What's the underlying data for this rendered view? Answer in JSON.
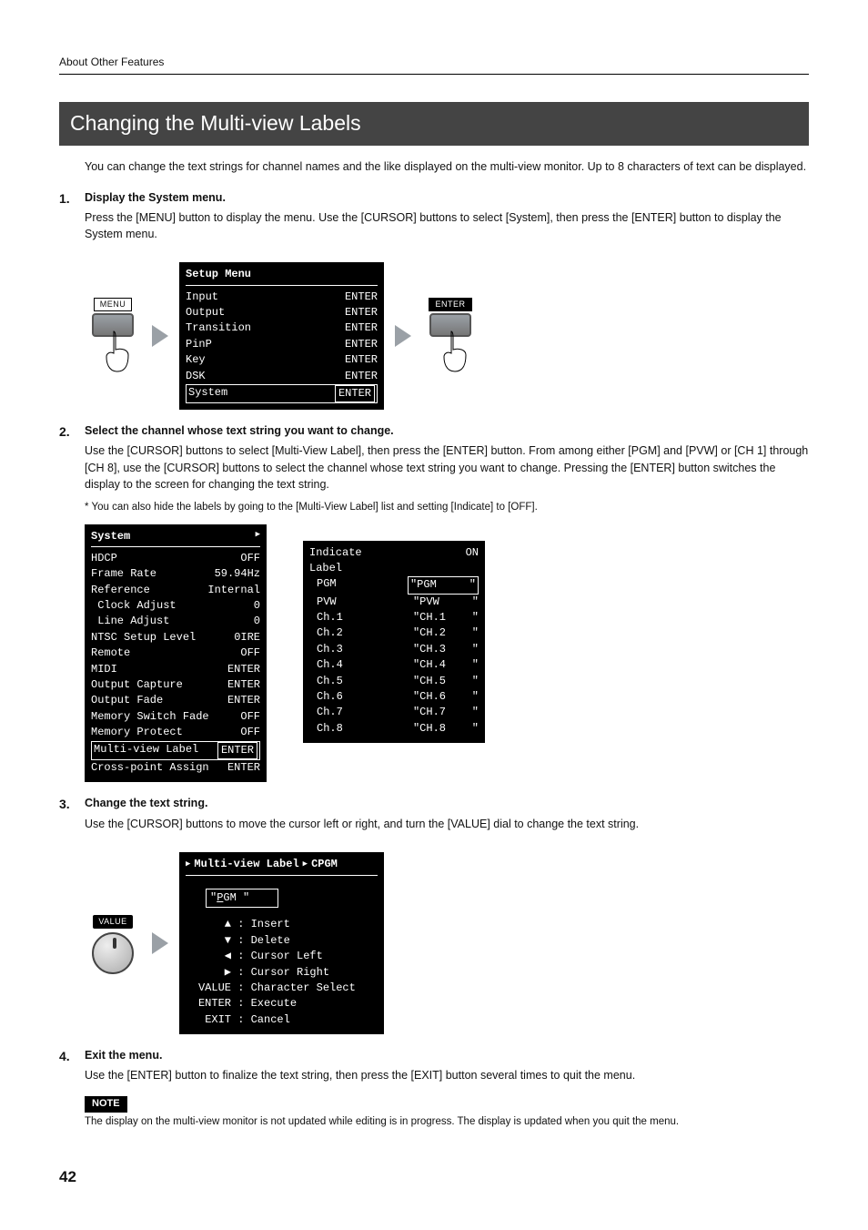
{
  "header": {
    "section_link": "About Other Features"
  },
  "title": "Changing the Multi-view Labels",
  "intro": "You can change the text strings for channel names and the like displayed on the multi-view monitor. Up to 8 characters of text can be displayed.",
  "steps": [
    {
      "num": "1.",
      "title": "Display the System menu.",
      "text": "Press the [MENU] button to display the menu. Use the [CURSOR] buttons to select [System], then press the [ENTER] button to display the System menu."
    },
    {
      "num": "2.",
      "title": "Select the channel whose text string you want to change.",
      "text": "Use the [CURSOR] buttons to select [Multi-View Label], then press the [ENTER] button. From among either [PGM] and [PVW] or [CH 1] through [CH 8], use the [CURSOR] buttons to select the channel whose text string you want to change. Pressing the [ENTER] button switches the display to the screen for changing the text string.",
      "footnote": "*  You can also hide the labels by going to the [Multi-View Label] list and setting [Indicate] to [OFF]."
    },
    {
      "num": "3.",
      "title": "Change the text string.",
      "text": "Use the [CURSOR] buttons to move the cursor left or right, and turn the [VALUE] dial to change the text string."
    },
    {
      "num": "4.",
      "title": "Exit the menu.",
      "text": "Use the [ENTER] button to finalize the text string, then press the [EXIT] button several times to quit the menu."
    }
  ],
  "hw": {
    "menu_label": "MENU",
    "enter_label": "ENTER",
    "value_label": "VALUE"
  },
  "lcd_setup": {
    "title": "Setup Menu",
    "items": [
      {
        "l": "Input",
        "r": "ENTER"
      },
      {
        "l": "Output",
        "r": "ENTER"
      },
      {
        "l": "Transition",
        "r": "ENTER"
      },
      {
        "l": "PinP",
        "r": "ENTER"
      },
      {
        "l": "Key",
        "r": "ENTER"
      },
      {
        "l": "DSK",
        "r": "ENTER"
      }
    ],
    "highlight": {
      "l": "System",
      "r": "ENTER"
    }
  },
  "lcd_system": {
    "title": "System",
    "items": [
      {
        "l": "HDCP",
        "r": "OFF"
      },
      {
        "l": "Frame Rate",
        "r": "59.94Hz"
      },
      {
        "l": "Reference",
        "r": "Internal"
      },
      {
        "l": " Clock Adjust",
        "r": "0"
      },
      {
        "l": " Line Adjust",
        "r": "0"
      },
      {
        "l": "NTSC Setup Level",
        "r": "0IRE"
      },
      {
        "l": "Remote",
        "r": "OFF"
      },
      {
        "l": "MIDI",
        "r": "ENTER"
      },
      {
        "l": "Output Capture",
        "r": "ENTER"
      },
      {
        "l": "Output Fade",
        "r": "ENTER"
      },
      {
        "l": "Memory Switch Fade",
        "r": "OFF"
      },
      {
        "l": "Memory Protect",
        "r": "OFF"
      }
    ],
    "highlight": {
      "l": "Multi-view Label",
      "r": "ENTER"
    },
    "after": {
      "l": "Cross-point Assign",
      "r": "ENTER"
    }
  },
  "lcd_mv": {
    "indicate_label": "Indicate",
    "indicate_value": "ON",
    "label_heading": "Label",
    "pgm": {
      "l": "PGM",
      "r": "\"PGM     \""
    },
    "rows": [
      {
        "l": "PVW",
        "r": "\"PVW     \""
      },
      {
        "l": "Ch.1",
        "r": "\"CH.1    \""
      },
      {
        "l": "Ch.2",
        "r": "\"CH.2    \""
      },
      {
        "l": "Ch.3",
        "r": "\"CH.3    \""
      },
      {
        "l": "Ch.4",
        "r": "\"CH.4    \""
      },
      {
        "l": "Ch.5",
        "r": "\"CH.5    \""
      },
      {
        "l": "Ch.6",
        "r": "\"CH.6    \""
      },
      {
        "l": "Ch.7",
        "r": "\"CH.7    \""
      },
      {
        "l": "Ch.8",
        "r": "\"CH.8    \""
      }
    ]
  },
  "lcd_editor": {
    "breadcrumb1": "Multi-view Label",
    "breadcrumb2": "CPGM",
    "field_prefix": "\"",
    "field_cursor": "P",
    "field_rest": "GM     \"",
    "legend": [
      {
        "k": "▲",
        "v": "Insert"
      },
      {
        "k": "▼",
        "v": "Delete"
      },
      {
        "k": "◀",
        "v": "Cursor Left"
      },
      {
        "k": "▶",
        "v": "Cursor Right"
      },
      {
        "k": "VALUE",
        "v": "Character Select"
      },
      {
        "k": "ENTER",
        "v": "Execute"
      },
      {
        "k": "EXIT",
        "v": "Cancel"
      }
    ]
  },
  "note": {
    "tag": "NOTE",
    "text": "The display on the multi-view monitor is not updated while editing is in progress. The display is updated when you quit the menu."
  },
  "page_number": "42"
}
